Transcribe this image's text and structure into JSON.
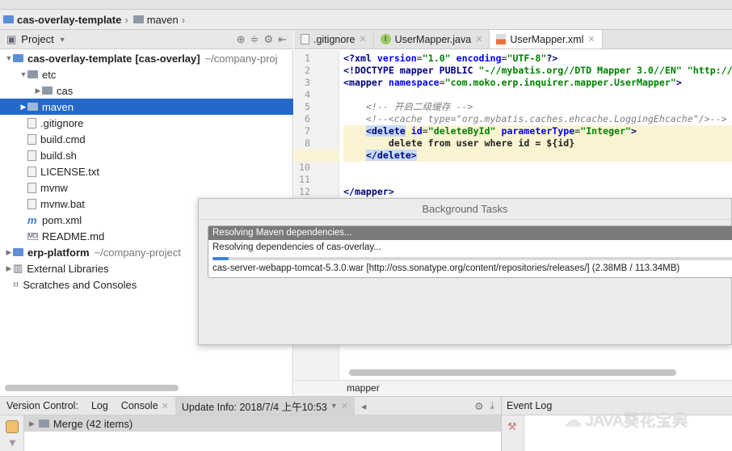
{
  "breadcrumb": [
    {
      "label": "cas-overlay-template"
    },
    {
      "label": "maven"
    }
  ],
  "project_panel": {
    "title": "Project",
    "tree": [
      {
        "label": "cas-overlay-template",
        "suffix": "[cas-overlay]",
        "path": "~/company-proj",
        "level": 0,
        "expanded": true,
        "type": "module"
      },
      {
        "label": "etc",
        "level": 1,
        "expanded": true,
        "type": "folder"
      },
      {
        "label": "cas",
        "level": 2,
        "expanded": false,
        "type": "folder"
      },
      {
        "label": "maven",
        "level": 1,
        "expanded": false,
        "type": "folder",
        "selected": true
      },
      {
        "label": ".gitignore",
        "level": 1,
        "type": "file"
      },
      {
        "label": "build.cmd",
        "level": 1,
        "type": "file"
      },
      {
        "label": "build.sh",
        "level": 1,
        "type": "file"
      },
      {
        "label": "LICENSE.txt",
        "level": 1,
        "type": "file"
      },
      {
        "label": "mvnw",
        "level": 1,
        "type": "file"
      },
      {
        "label": "mvnw.bat",
        "level": 1,
        "type": "file"
      },
      {
        "label": "pom.xml",
        "level": 1,
        "type": "maven"
      },
      {
        "label": "README.md",
        "level": 1,
        "type": "md"
      },
      {
        "label": "erp-platform",
        "path": "~/company-project",
        "level": 0,
        "expanded": false,
        "type": "module"
      },
      {
        "label": "External Libraries",
        "level": 0,
        "expanded": false,
        "type": "lib"
      },
      {
        "label": "Scratches and Consoles",
        "level": 0,
        "type": "scratch"
      }
    ]
  },
  "editor": {
    "tabs": [
      {
        "label": ".gitignore"
      },
      {
        "label": "UserMapper.java"
      },
      {
        "label": "UserMapper.xml",
        "active": true
      }
    ],
    "lines": [
      "1",
      "2",
      "3",
      "4",
      "5",
      "6",
      "7",
      "8",
      "9",
      "10",
      "11",
      "12"
    ],
    "status_breadcrumb": "mapper"
  },
  "background_tasks": {
    "title": "Background Tasks",
    "task_title": "Resolving Maven dependencies...",
    "task_detail": "Resolving dependencies of cas-overlay...",
    "progress_percent": 3,
    "file": "cas-server-webapp-tomcat-5.3.0.war [http://oss.sonatype.org/content/repositories/releases/]  (2.38MB / 113.34MB)"
  },
  "bottom": {
    "tabs": [
      {
        "label": "Version Control:"
      },
      {
        "label": "Log"
      },
      {
        "label": "Console"
      },
      {
        "label": "Update Info: 2018/7/4 上午10:53",
        "active": true
      }
    ],
    "merge_item": "Merge (42 items)",
    "event_log": "Event Log"
  },
  "watermark": "JAVA葵花宝典"
}
